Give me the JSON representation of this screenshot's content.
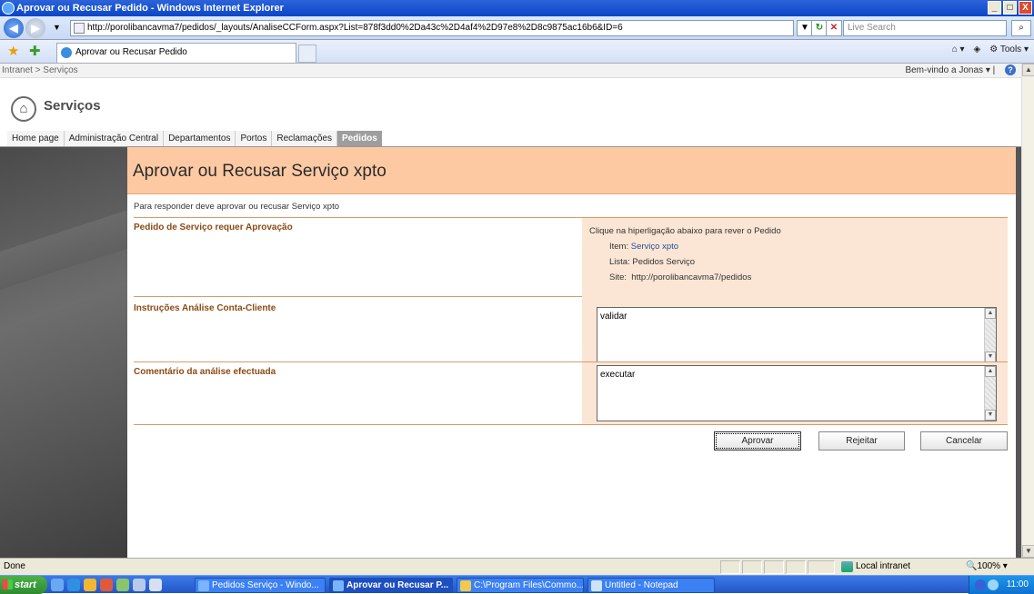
{
  "window": {
    "title": "Aprovar ou Recusar Pedido - Windows Internet Explorer",
    "minimize": "_",
    "maximize": "□",
    "close": "X"
  },
  "browser": {
    "url": "http://porolibancavma7/pedidos/_layouts/AnaliseCCForm.aspx?List=878f3dd0%2Da43c%2D4af4%2D97e8%2D8c9875ac16b6&ID=6",
    "search_placeholder": "Live Search",
    "tab_label": "Aprovar ou Recusar Pedido",
    "tools_label": "Tools"
  },
  "page": {
    "breadcrumb": "Intranet > Serviços",
    "welcome": "Bem-vindo a Jonas",
    "site_title": "Serviços",
    "nav": [
      "Home page",
      "Administração Central",
      "Departamentos",
      "Portos",
      "Reclamações",
      "Pedidos"
    ],
    "nav_selected": "Pedidos",
    "form_title": "Aprovar ou Recusar Serviço xpto",
    "intro": "Para responder deve aprovar ou recusar Serviço xpto",
    "section1": {
      "label": "Pedido de Serviço requer Aprovação",
      "hint": "Clique na hiperligação abaixo para rever o Pedido",
      "item_label": "Item:",
      "item_value": "Serviço xpto",
      "list_label": "Lista:",
      "list_value": "Pedidos Serviço",
      "site_label": "Site:",
      "site_value": "http://porolibancavma7/pedidos"
    },
    "section2": {
      "label": "Instruções Análise Conta-Cliente",
      "value": "validar"
    },
    "section3": {
      "label": "Comentário da análise efectuada",
      "value": "executar"
    },
    "buttons": {
      "approve": "Aprovar",
      "reject": "Rejeitar",
      "cancel": "Cancelar"
    }
  },
  "statusbar": {
    "text": "Done",
    "zone": "Local intranet",
    "zoom": "100%"
  },
  "taskbar": {
    "start": "start",
    "tasks": [
      "Pedidos Serviço - Windo...",
      "Aprovar ou Recusar P...",
      "C:\\Program Files\\Commo...",
      "Untitled - Notepad"
    ],
    "clock": "11:00"
  },
  "colors": {
    "header_peach": "#fdc9a3",
    "label_brown": "#8b4b14",
    "info_bg": "#fbe6d5",
    "ie_blue": "#0b46c8"
  }
}
